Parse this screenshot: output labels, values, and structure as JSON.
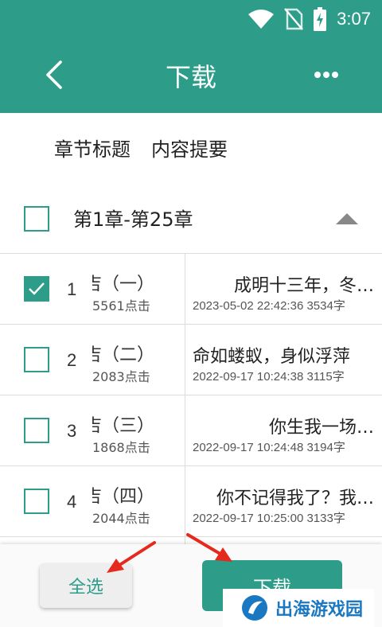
{
  "status_bar": {
    "time": "3:07"
  },
  "app_bar": {
    "title": "下载"
  },
  "tabs": [
    "章节标题",
    "内容提要"
  ],
  "group": {
    "label": "第1章-第25章",
    "checked": false
  },
  "rows": [
    {
      "num": "1",
      "left_title": "吉（一）",
      "left_clicks": "5561点击",
      "right_title": "成明十三年，冬…",
      "right_meta": "2023-05-02 22:42:36  3534字",
      "checked": true
    },
    {
      "num": "2",
      "left_title": "吉（二）",
      "left_clicks": "2083点击",
      "right_title": "命如蝼蚁，身似浮萍",
      "right_meta": "2022-09-17 10:24:38  3115字",
      "checked": false
    },
    {
      "num": "3",
      "left_title": "吉（三）",
      "left_clicks": "1868点击",
      "right_title": "你生我一场…",
      "right_meta": "2022-09-17 10:24:48  3194字",
      "checked": false
    },
    {
      "num": "4",
      "left_title": "吉（四）",
      "left_clicks": "2044点击",
      "right_title": "你不记得我了？我…",
      "right_meta": "2022-09-17 10:25:00  3133字",
      "checked": false
    }
  ],
  "bottom": {
    "select_all": "全选",
    "download": "下载"
  },
  "watermark": {
    "text": "出海游戏园"
  },
  "colors": {
    "primary": "#2d9d8a",
    "arrow": "#e5291c"
  },
  "icons": {
    "back": "chevron-left-icon",
    "more": "more-horizontal-icon",
    "collapse": "triangle-up-icon"
  }
}
